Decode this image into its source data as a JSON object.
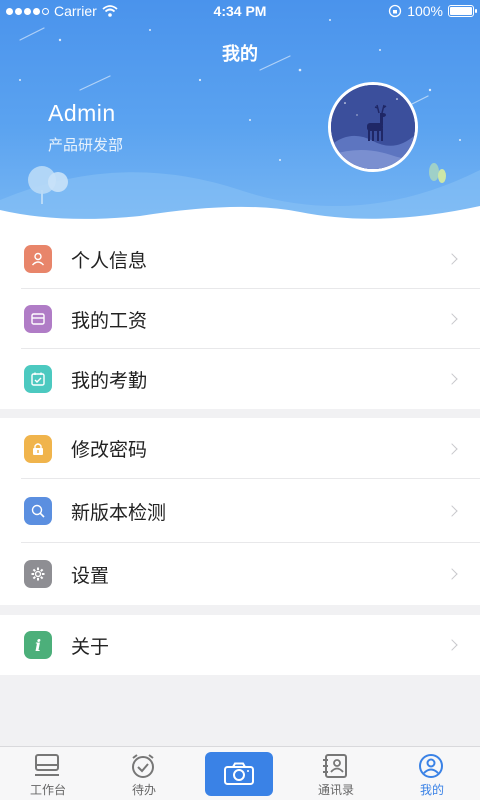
{
  "status_bar": {
    "carrier": "Carrier",
    "time": "4:34 PM",
    "battery": "100%",
    "battery_level": 1.0
  },
  "header": {
    "title": "我的",
    "user_name": "Admin",
    "department": "产品研发部"
  },
  "menu_groups": [
    [
      {
        "label": "个人信息",
        "icon": "person-icon",
        "color": "#e8856a"
      },
      {
        "label": "我的工资",
        "icon": "wallet-icon",
        "color": "#b07cc6"
      },
      {
        "label": "我的考勤",
        "icon": "calendar-check-icon",
        "color": "#4cc9c0"
      }
    ],
    [
      {
        "label": "修改密码",
        "icon": "lock-icon",
        "color": "#f0b44c"
      },
      {
        "label": "新版本检测",
        "icon": "search-update-icon",
        "color": "#5b8fe0"
      },
      {
        "label": "设置",
        "icon": "gear-icon",
        "color": "#8e8e93"
      }
    ],
    [
      {
        "label": "关于",
        "icon": "info-icon",
        "color": "#4caf7a"
      }
    ]
  ],
  "tabbar": {
    "tabs": [
      {
        "label": "工作台",
        "icon": "workbench-icon"
      },
      {
        "label": "待办",
        "icon": "alarm-clock-icon"
      },
      {
        "label": "",
        "icon": "camera-icon"
      },
      {
        "label": "通讯录",
        "icon": "contacts-icon"
      },
      {
        "label": "我的",
        "icon": "profile-icon",
        "active": true
      }
    ],
    "active_color": "#3a82e6"
  }
}
